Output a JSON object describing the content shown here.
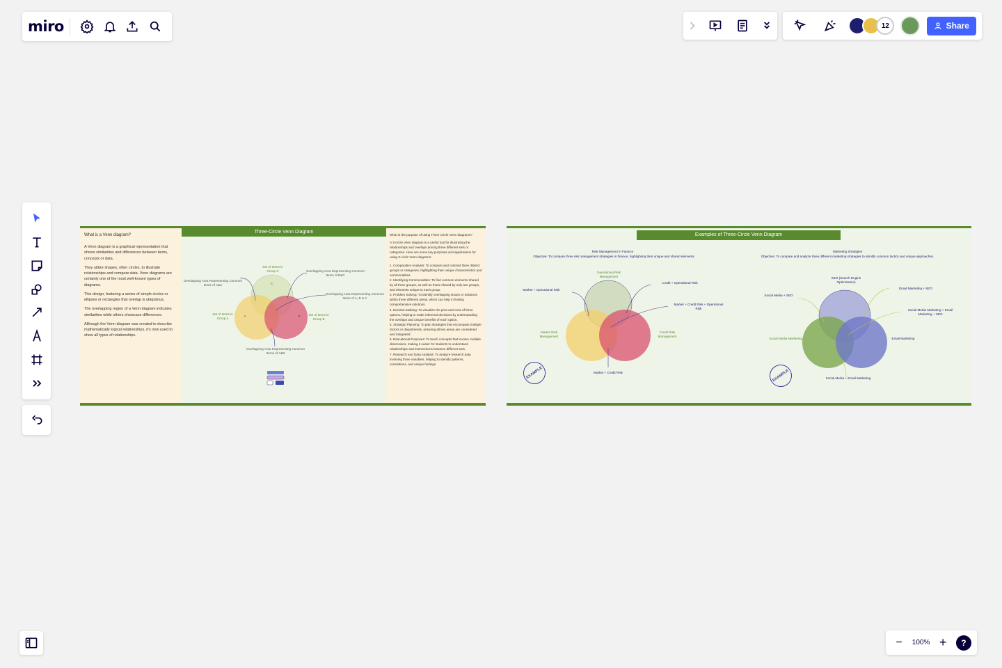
{
  "app": {
    "logo": "miro",
    "top_icons": [
      "settings-icon",
      "bell-icon",
      "upload-icon",
      "search-icon"
    ]
  },
  "collab_toolbar": {
    "icons": [
      "chevron-right-icon",
      "present-icon",
      "notes-icon",
      "more-chevrons-icon"
    ]
  },
  "share_bar": {
    "icons": [
      "cursor-follow-icon",
      "celebrate-icon"
    ],
    "avatar_count": "12",
    "share_label": "Share"
  },
  "left_toolbar": {
    "tools": [
      "select-tool",
      "text-tool",
      "sticky-note-tool",
      "shapes-tool",
      "connector-tool",
      "pen-tool",
      "frame-tool",
      "more-tools"
    ]
  },
  "zoom": {
    "level": "100%",
    "minus": "−",
    "plus": "+",
    "help": "?"
  },
  "colors": {
    "accent": "#4262ff",
    "frame_green": "#5a8a2e",
    "cream": "#fbf1dc",
    "mint": "#eef5e8"
  },
  "board": {
    "frame1": {
      "title": "Three-Circle Venn Diagram",
      "left_heading": "What is a Venn diagram?",
      "left_paragraphs": [
        "A Venn diagram is a graphical representation that shows similarities and differences between items, concepts or data.",
        "They utilize shapes, often circles, to illustrate relationships and compare data. Venn diagrams are certainly one of the most well-known types of diagrams.",
        "This design, featuring a series of simple circles or ellipses or rectangles that overlap is ubiquitous.",
        "The overlapping region of a Venn diagram indicates similarities while others showcase differences.",
        "Although the Venn diagram was created to describe mathematically logical relationships, it's now used to show all types of relationships."
      ],
      "right_heading": "What is the purpose of using Three Circle Venn diagrams?",
      "right_intro": "A 3-circle Venn diagram is a useful tool for illustrating the relationships and overlaps among three different sets or categories. Here are some key purposes and applications for using 3-circle Venn diagrams:",
      "right_points": [
        "1. Comparative Analysis: To compare and contrast three distinct groups or categories, highlighting their unique characteristics and commonalities.",
        "2. Identifying Commonalities: To find common elements shared by all three groups, as well as those shared by only two groups, and elements unique to each group.",
        "3. Problem Solving: To identify overlapping issues or solutions within three different areas, which can help in finding comprehensive solutions.",
        "4. Decision Making: To visualize the pros and cons of three options, helping to make informed decisions by understanding the overlaps and unique benefits of each option.",
        "5. Strategic Planning: To plan strategies that encompass multiple factors or departments, ensuring all key areas are considered and integrated.",
        "6. Educational Purposes: To teach concepts that involve multiple dimensions, making it easier for students to understand relationships and intersections between different sets.",
        "7. Research and Data Analysis: To analyze research data involving three variables, helping to identify patterns, correlations, and unique findings."
      ],
      "venn_labels": {
        "c_set": "Set of Items in Group C",
        "a_set": "Set of Items in Group A",
        "b_set": "Set of Items in Group B",
        "ac": "Overlapping Area Representing Common Items of A&C",
        "bc": "Overlapping Area Representing Common Items of B&C",
        "abc": "Overlapping Area Representing Common Items of A, B & C",
        "ab": "Overlapping Area Representing Common Items of A&B",
        "a": "A",
        "b": "B",
        "c": "C"
      }
    },
    "frame2": {
      "title": "Examples of Three-Circle Venn Diagram",
      "ex1": {
        "heading": "Risk Management in Finance",
        "objective": "Objective: To compare three risk management strategies in finance, highlighting their unique and shared elements",
        "top": "Operational Risk Management",
        "left": "Market Risk Management",
        "right": "Credit Risk Management",
        "mo": "Market + Operational Risk",
        "co": "Credit + Operational Risk",
        "mco": "Market + Credit Risk + Operational Risk",
        "mc": "Market + Credit Risk",
        "stamp": "EXAMPLE"
      },
      "ex2": {
        "heading": "Marketing Strategies",
        "objective": "Objective: To compare and analyze three different marketing strategies to identify common tactics and unique approaches.",
        "top": "SEO (Search Engine Optimization)",
        "left": "Social Media Marketing",
        "right": "Email Marketing",
        "ss": "Social Media + SEO",
        "es": "Email Marketing + SEO",
        "ses": "Social Media Marketing + Email Marketing + SEO",
        "se": "Social Media + Email Marketing",
        "stamp": "EXAMPLE"
      }
    }
  }
}
